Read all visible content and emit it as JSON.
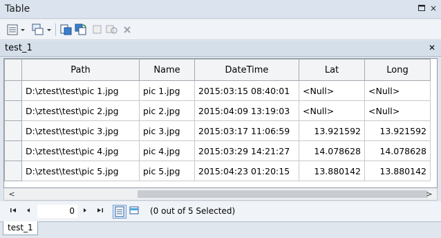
{
  "window": {
    "title": "Table"
  },
  "table_tab": {
    "name": "test_1"
  },
  "columns": [
    "Path",
    "Name",
    "DateTime",
    "Lat",
    "Long"
  ],
  "rows": [
    {
      "path": "D:\\ztest\\test\\pic 1.jpg",
      "name": "pic 1.jpg",
      "datetime": "2015:03:15 08:40:01",
      "lat": "<Null>",
      "long": "<Null>"
    },
    {
      "path": "D:\\ztest\\test\\pic 2.jpg",
      "name": "pic 2.jpg",
      "datetime": "2015:04:09 13:19:03",
      "lat": "<Null>",
      "long": "<Null>"
    },
    {
      "path": "D:\\ztest\\test\\pic 3.jpg",
      "name": "pic 3.jpg",
      "datetime": "2015:03:17 11:06:59",
      "lat": "13.921592",
      "long": "13.921592"
    },
    {
      "path": "D:\\ztest\\test\\pic 4.jpg",
      "name": "pic 4.jpg",
      "datetime": "2015:03:29 14:21:27",
      "lat": "14.078628",
      "long": "14.078628"
    },
    {
      "path": "D:\\ztest\\test\\pic 5.jpg",
      "name": "pic 5.jpg",
      "datetime": "2015:04:23 01:20:15",
      "lat": "13.880142",
      "long": "13.880142"
    }
  ],
  "navigation": {
    "current_record": "0",
    "selection_status": "(0 out of 5 Selected)"
  },
  "bottom_tab": {
    "label": "test_1"
  },
  "colors": {
    "titlebar": "#dbe4ee",
    "header_bg": "#f3f4f6",
    "accent": "#2a6ebb"
  }
}
